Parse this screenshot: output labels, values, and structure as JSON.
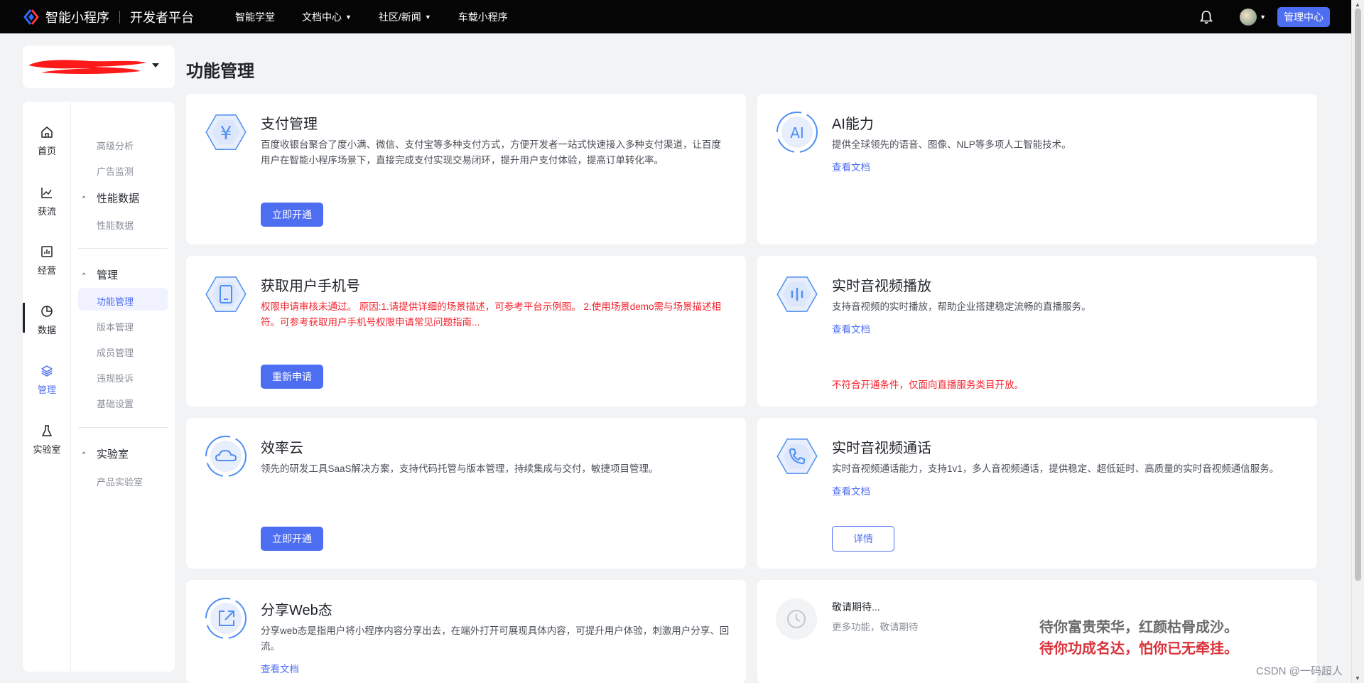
{
  "topbar": {
    "brand_name": "智能小程序",
    "brand_sub": "开发者平台",
    "nav": [
      {
        "label": "智能学堂",
        "has_caret": false
      },
      {
        "label": "文档中心",
        "has_caret": true
      },
      {
        "label": "社区/新闻",
        "has_caret": true
      },
      {
        "label": "车载小程序",
        "has_caret": false
      }
    ],
    "admin_label": "管理中心"
  },
  "sidebar": {
    "rail": [
      {
        "label": "首页",
        "icon": "home-icon"
      },
      {
        "label": "获流",
        "icon": "trend-icon"
      },
      {
        "label": "经营",
        "icon": "chart-box-icon"
      },
      {
        "label": "数据",
        "icon": "pie-chart-icon"
      },
      {
        "label": "管理",
        "icon": "layers-icon",
        "active": true
      },
      {
        "label": "实验室",
        "icon": "flask-icon"
      }
    ],
    "subnav": {
      "data_items": [
        "高级分析",
        "广告监测"
      ],
      "perf_group": "性能数据",
      "perf_items": [
        "性能数据"
      ],
      "manage_group": "管理",
      "manage_items": [
        "功能管理",
        "版本管理",
        "成员管理",
        "违规投诉",
        "基础设置"
      ],
      "lab_group": "实验室",
      "lab_items": [
        "产品实验室"
      ]
    }
  },
  "main": {
    "title": "功能管理",
    "cards": {
      "pay": {
        "title": "支付管理",
        "desc": "百度收银台聚合了度小满、微信、支付宝等多种支付方式，方便开发者一站式快速接入多种支付渠道，让百度用户在智能小程序场景下，直接完成支付实现交易闭环，提升用户支付体验，提高订单转化率。",
        "button": "立即开通"
      },
      "ai": {
        "title": "AI能力",
        "desc": "提供全球领先的语音、图像、NLP等多项人工智能技术。",
        "link": "查看文档"
      },
      "phone": {
        "title": "获取用户手机号",
        "desc": "权限申请审核未通过。 原因:1.请提供详细的场景描述，可参考平台示例图。 2.使用场景demo需与场景描述相符。可参考获取用户手机号权限申请常见问题指南...",
        "button": "重新申请"
      },
      "live": {
        "title": "实时音视频播放",
        "desc": "支持音视频的实时播放，帮助企业搭建稳定流畅的直播服务。",
        "link": "查看文档",
        "warn": "不符合开通条件，仅面向直播服务类目开放。"
      },
      "cloud": {
        "title": "效率云",
        "desc": "领先的研发工具SaaS解决方案，支持代码托管与版本管理，持续集成与交付，敏捷项目管理。",
        "button": "立即开通"
      },
      "call": {
        "title": "实时音视频通话",
        "desc": "实时音视频通话能力，支持1v1，多人音视频通话，提供稳定、超低延时、高质量的实时音视频通信服务。",
        "link": "查看文档",
        "button": "详情"
      },
      "web": {
        "title": "分享Web态",
        "desc": "分享web态是指用户将小程序内容分享出去，在端外打开可展现具体内容，可提升用户体验，刺激用户分享、回流。",
        "link": "查看文档"
      },
      "coming": {
        "title": "敬请期待...",
        "desc": "更多功能，敬请期待"
      }
    }
  },
  "overlay": {
    "poem_line1": "待你富贵荣华，红颜枯骨成沙。",
    "poem_line2": "待你功成名达，怕你已无牵挂。",
    "watermark": "CSDN @一码超人"
  },
  "colors": {
    "accent": "#4e6ef2",
    "error": "#f5222d",
    "topbar": "#050505",
    "background": "#f2f3f5"
  }
}
